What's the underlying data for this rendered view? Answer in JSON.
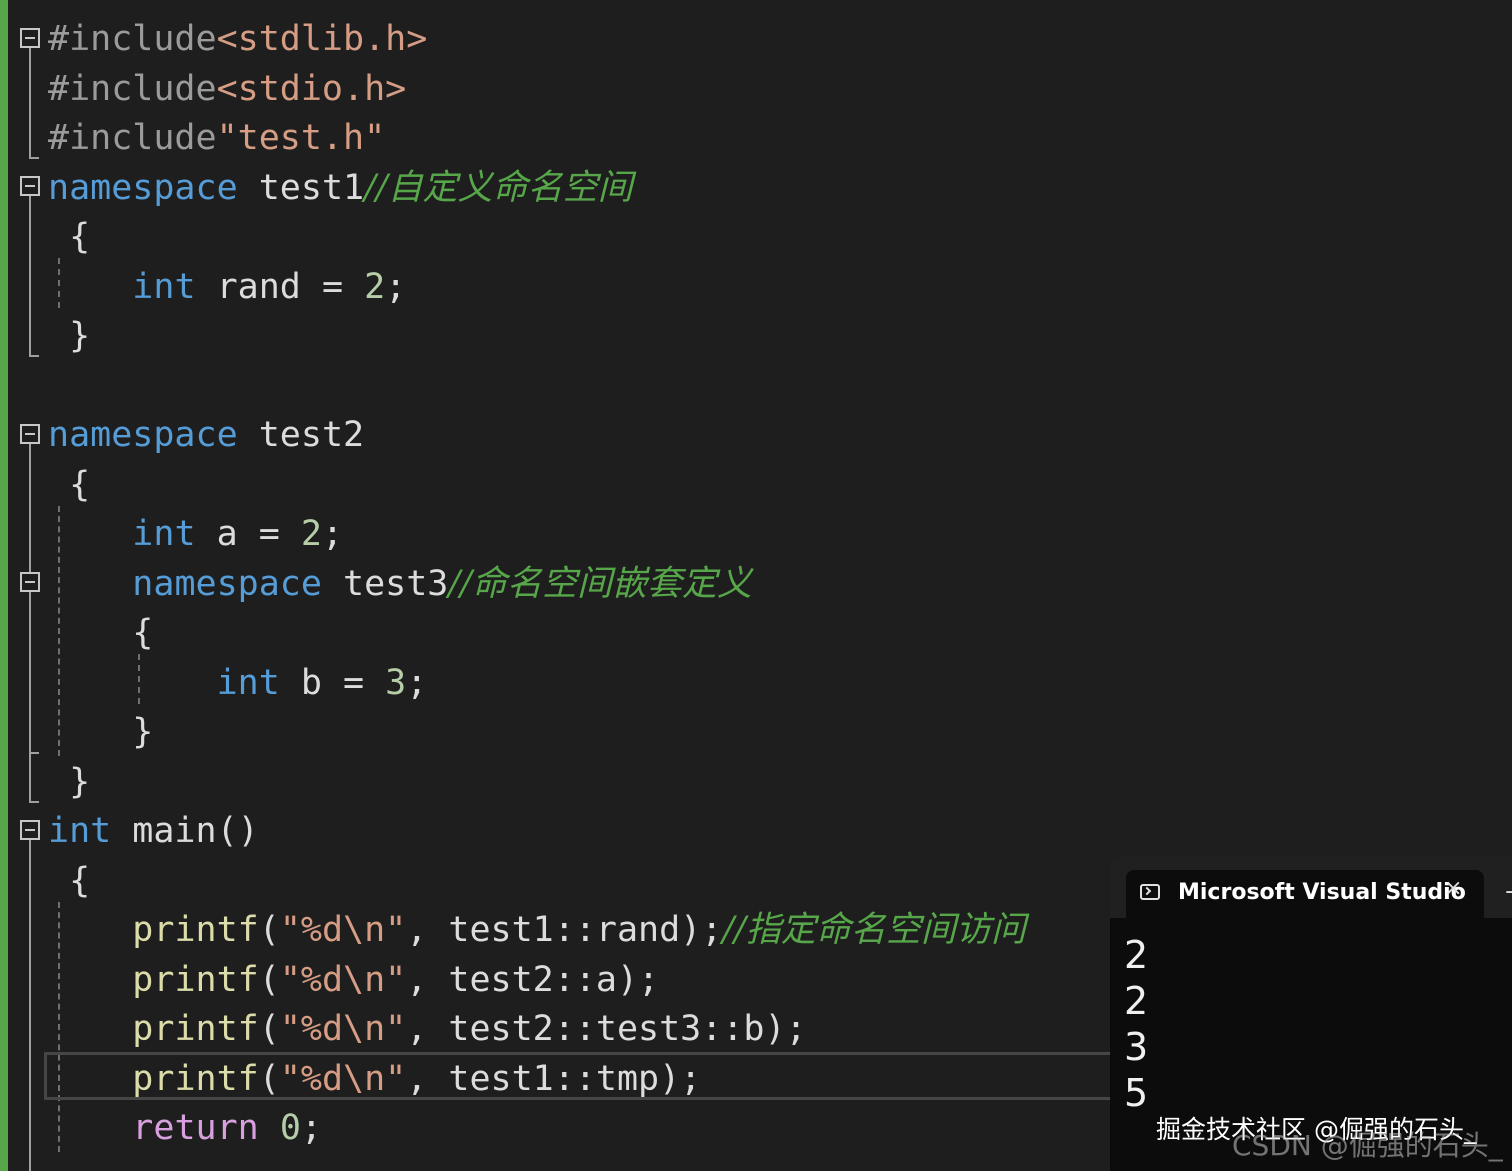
{
  "editor": {
    "lines": [
      {
        "tokens": [
          {
            "t": "#include",
            "c": "pp"
          },
          {
            "t": "<stdlib.h>",
            "c": "str"
          }
        ]
      },
      {
        "tokens": [
          {
            "t": "#include",
            "c": "pp"
          },
          {
            "t": "<stdio.h>",
            "c": "str"
          }
        ]
      },
      {
        "tokens": [
          {
            "t": "#include",
            "c": "pp"
          },
          {
            "t": "\"test.h\"",
            "c": "str"
          }
        ]
      },
      {
        "tokens": [
          {
            "t": "namespace",
            "c": "kw"
          },
          {
            "t": " test1",
            "c": "id"
          },
          {
            "t": "//自定义命名空间",
            "c": "cm"
          }
        ]
      },
      {
        "tokens": [
          {
            "t": " {",
            "c": "id"
          }
        ]
      },
      {
        "tokens": [
          {
            "t": "    ",
            "c": "id"
          },
          {
            "t": "int",
            "c": "kw"
          },
          {
            "t": " rand = ",
            "c": "id"
          },
          {
            "t": "2",
            "c": "num"
          },
          {
            "t": ";",
            "c": "id"
          }
        ]
      },
      {
        "tokens": [
          {
            "t": " }",
            "c": "id"
          }
        ]
      },
      {
        "tokens": []
      },
      {
        "tokens": [
          {
            "t": "namespace",
            "c": "kw"
          },
          {
            "t": " test2",
            "c": "id"
          }
        ]
      },
      {
        "tokens": [
          {
            "t": " {",
            "c": "id"
          }
        ]
      },
      {
        "tokens": [
          {
            "t": "    ",
            "c": "id"
          },
          {
            "t": "int",
            "c": "kw"
          },
          {
            "t": " a = ",
            "c": "id"
          },
          {
            "t": "2",
            "c": "num"
          },
          {
            "t": ";",
            "c": "id"
          }
        ]
      },
      {
        "tokens": [
          {
            "t": "    ",
            "c": "id"
          },
          {
            "t": "namespace",
            "c": "kw"
          },
          {
            "t": " test3",
            "c": "id"
          },
          {
            "t": "//命名空间嵌套定义",
            "c": "cm"
          }
        ]
      },
      {
        "tokens": [
          {
            "t": "    {",
            "c": "id"
          }
        ]
      },
      {
        "tokens": [
          {
            "t": "        ",
            "c": "id"
          },
          {
            "t": "int",
            "c": "kw"
          },
          {
            "t": " b = ",
            "c": "id"
          },
          {
            "t": "3",
            "c": "num"
          },
          {
            "t": ";",
            "c": "id"
          }
        ]
      },
      {
        "tokens": [
          {
            "t": "    }",
            "c": "id"
          }
        ]
      },
      {
        "tokens": [
          {
            "t": " }",
            "c": "id"
          }
        ]
      },
      {
        "tokens": [
          {
            "t": "int",
            "c": "kw"
          },
          {
            "t": " main()",
            "c": "id"
          }
        ]
      },
      {
        "tokens": [
          {
            "t": " {",
            "c": "id"
          }
        ]
      },
      {
        "tokens": [
          {
            "t": "    ",
            "c": "id"
          },
          {
            "t": "printf",
            "c": "fn"
          },
          {
            "t": "(",
            "c": "id"
          },
          {
            "t": "\"%d\\n\"",
            "c": "str"
          },
          {
            "t": ", test1::rand);",
            "c": "id"
          },
          {
            "t": "//指定命名空间访问",
            "c": "cm"
          }
        ]
      },
      {
        "tokens": [
          {
            "t": "    ",
            "c": "id"
          },
          {
            "t": "printf",
            "c": "fn"
          },
          {
            "t": "(",
            "c": "id"
          },
          {
            "t": "\"%d\\n\"",
            "c": "str"
          },
          {
            "t": ", test2::a);",
            "c": "id"
          }
        ]
      },
      {
        "tokens": [
          {
            "t": "    ",
            "c": "id"
          },
          {
            "t": "printf",
            "c": "fn"
          },
          {
            "t": "(",
            "c": "id"
          },
          {
            "t": "\"%d\\n\"",
            "c": "str"
          },
          {
            "t": ", test2::test3::b);",
            "c": "id"
          }
        ]
      },
      {
        "tokens": [
          {
            "t": "    ",
            "c": "id"
          },
          {
            "t": "printf",
            "c": "fn"
          },
          {
            "t": "(",
            "c": "id"
          },
          {
            "t": "\"%d\\n\"",
            "c": "str"
          },
          {
            "t": ", test1::tmp);",
            "c": "id"
          }
        ]
      },
      {
        "tokens": [
          {
            "t": "    ",
            "c": "id"
          },
          {
            "t": "return",
            "c": "kw2"
          },
          {
            "t": " ",
            "c": "id"
          },
          {
            "t": "0",
            "c": "num"
          },
          {
            "t": ";",
            "c": "id"
          }
        ]
      }
    ]
  },
  "console": {
    "title": "Microsoft Visual Studio",
    "close_glyph": "×",
    "output": [
      "2",
      "2",
      "3",
      "5"
    ]
  },
  "watermarks": {
    "juejin": "掘金技术社区 @倔强的石头_",
    "csdn": "CSDN @倔强的石头_"
  }
}
